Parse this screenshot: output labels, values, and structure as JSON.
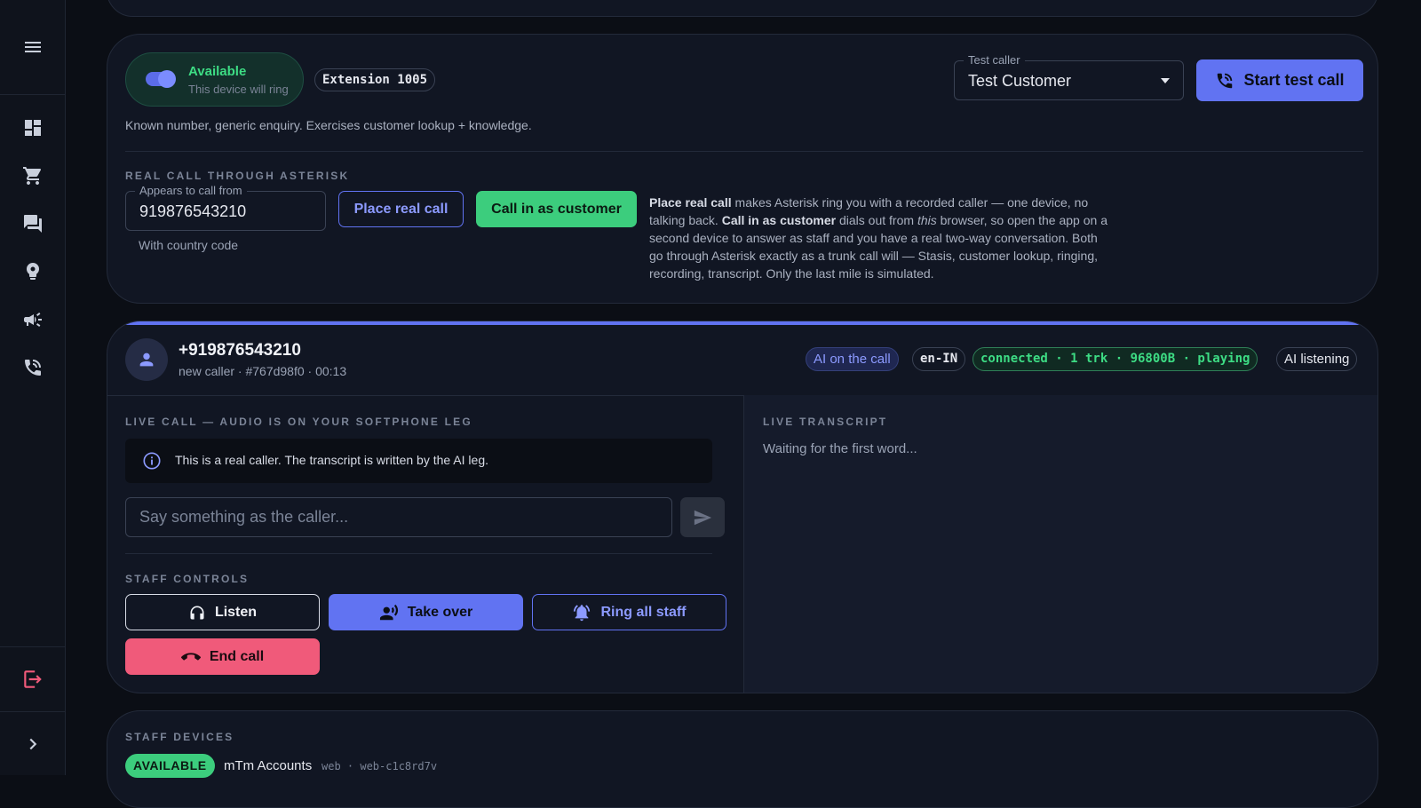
{
  "test_panel": {
    "availability_title": "Available",
    "availability_subtitle": "This device will ring",
    "extension": "Extension 1005",
    "test_caller_label": "Test caller",
    "test_caller_value": "Test Customer",
    "start_test_call": "Start test call",
    "scenario_description": "Known number, generic enquiry. Exercises customer lookup + knowledge.",
    "real_call_label": "REAL CALL THROUGH ASTERISK",
    "appears_from_label": "Appears to call from",
    "appears_from_value": "919876543210",
    "country_code_hint": "With country code",
    "place_real_call": "Place real call",
    "call_in_as_customer": "Call in as customer",
    "help_bold_1": "Place real call",
    "help_text_1": " makes Asterisk ring you with a recorded caller — one device, no talking back. ",
    "help_bold_2": "Call in as customer",
    "help_text_2": " dials out from ",
    "help_italic": "this",
    "help_text_3": " browser, so open the app on a second device to answer as staff and you have a real two-way conversation. Both go through Asterisk exactly as a trunk call will — Stasis, customer lookup, ringing, recording, transcript. Only the last mile is simulated."
  },
  "call": {
    "number": "+919876543210",
    "meta": "new caller · #767d98f0 · 00:13",
    "tags": {
      "ai": "AI on the call",
      "lang": "en-IN",
      "status": "connected · 1 trk · 96800B · playing",
      "listening": "AI listening"
    },
    "live_label": "LIVE CALL — AUDIO IS ON YOUR SOFTPHONE LEG",
    "info_text": "This is a real caller. The transcript is written by the AI leg.",
    "say_placeholder": "Say something as the caller...",
    "staff_controls_label": "STAFF CONTROLS",
    "controls": {
      "listen": "Listen",
      "take_over": "Take over",
      "ring_all": "Ring all staff",
      "end_call": "End call"
    },
    "transcript_label": "LIVE TRANSCRIPT",
    "transcript_waiting": "Waiting for the first word..."
  },
  "devices": {
    "label": "STAFF DEVICES",
    "items": [
      {
        "status": "AVAILABLE",
        "name": "mTm Accounts",
        "meta": "web · web-c1c8rd7v"
      }
    ]
  },
  "colors": {
    "accent": "#6173f2",
    "success": "#3ccd7d",
    "danger": "#f05a7a",
    "background": "#0b0e15",
    "card": "#111623"
  },
  "icons": {
    "sidebar": [
      "menu-icon",
      "dashboard-icon",
      "cart-icon",
      "forum-icon",
      "support-agent-icon",
      "campaign-icon",
      "phone-in-talk-icon",
      "logout-icon",
      "chevron-right-icon"
    ]
  }
}
